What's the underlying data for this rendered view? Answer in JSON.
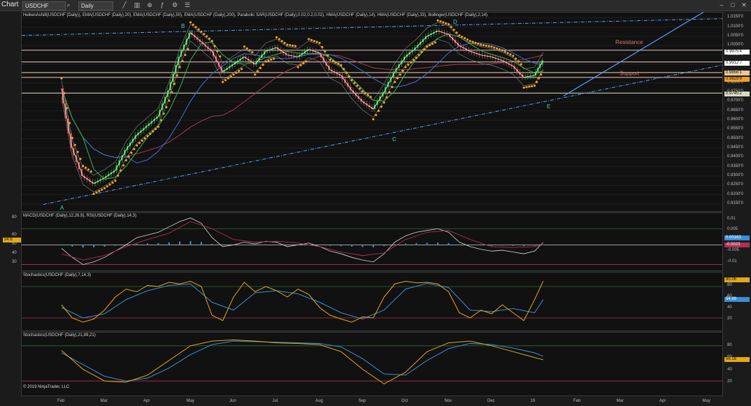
{
  "toolbar": {
    "title": "Chart",
    "instrument": "USDCHF",
    "interval": "Daily"
  },
  "panels": {
    "price_title": "HeikenAshi8(USDCHF (Daily)), EMA(USDCHF (Daily),20), EMA(USDCHF (Daily),50), EMA(USDCHF (Daily),200), Parabolic SAR(USDCHF (Daily),0.02,0.2,0.02), HMA(USDCHF (Daily),14), HMA(USDCHF (Daily),33), Bollinger(USDCHF (Daily),2,14)",
    "macd_title": "MACD(USDCHF (Daily),12,26,9), RSI(USDCHF (Daily),14,3)",
    "stoch1_title": "Stochastics(USDCHF (Daily),7,14,3)",
    "stoch2_title": "Stochastics(USDCHF (Daily),21,89,21)",
    "copyright": "© 2019 NinjaTrader, LLC"
  },
  "price_labels": {
    "resistance": "Resistance",
    "support": "Support",
    "A": "A",
    "B": "B",
    "C": "C",
    "D": "D",
    "E": "E"
  },
  "price_ticks": [
    "1.0150'0",
    "1.0100'0",
    "1.0050'0",
    "1.0000'0",
    "0.9950'0",
    "0.9900'0",
    "0.9850'0",
    "0.9800'0",
    "0.9750'0",
    "0.9700'0",
    "0.9650'0",
    "0.9600'0",
    "0.9550'0",
    "0.9500'0",
    "0.9450'0",
    "0.9400'0",
    "0.9350'0",
    "0.9300'0",
    "0.9250'0",
    "0.9200'0",
    "0.9150'0"
  ],
  "price_tags": [
    "0.9975'4",
    "0.9912'7",
    "0.9856'1",
    "0.9829'9",
    "0.9745'2"
  ],
  "macd_ticks_left": [
    "80",
    "60",
    "50",
    "40",
    "30"
  ],
  "macd_ticks_right": [
    "0.01",
    "0.005",
    "-0.005",
    "-0.01"
  ],
  "macd_tags": {
    "rsi_left": "54.6",
    "macd": "0.00163",
    "signal": "-0.0023"
  },
  "stoch_ticks": [
    "80",
    "60",
    "40",
    "20"
  ],
  "stoch1_tags": [
    "90.06",
    "54.89"
  ],
  "stoch2_tags": [
    "56.16"
  ],
  "x_labels": [
    "Feb",
    "Mar",
    "Apr",
    "May",
    "Jun",
    "Jul",
    "Aug",
    "Sep",
    "Oct",
    "Nov",
    "Dec",
    "19",
    "Feb",
    "Mar",
    "Apr",
    "May"
  ],
  "colors": {
    "background": "#111111",
    "bull_candle": "#2ecc40",
    "bear_candle": "#e05a5a",
    "sar_dots": "#f0a020",
    "ema20": "#3cb44b",
    "ema50": "#4070d0",
    "ema200": "#a04050",
    "hma14": "#e6e6e6",
    "trendline": "#5aa0ff",
    "resistance": "#f3c6c6",
    "stoch_k": "#e6a817",
    "stoch_d": "#3a8fd8",
    "macd_hist": "#3a8fd8",
    "level_line": "#b03050"
  },
  "chart_data": [
    {
      "type": "candlestick",
      "title": "HeikenAshi8(USDCHF (Daily)), EMA(USDCHF (Daily),20), EMA(USDCHF (Daily),50), EMA(USDCHF (Daily),200), Parabolic SAR(USDCHF (Daily),0.02,0.2,0.02), HMA(USDCHF (Daily),14), HMA(USDCHF (Daily),33), Bollinger(USDCHF (Daily),2,14)",
      "ylim": [
        0.912,
        1.017
      ],
      "x": [
        "Feb",
        "Mar",
        "Apr",
        "May",
        "Jun",
        "Jul",
        "Aug",
        "Sep",
        "Oct",
        "Nov",
        "Dec",
        "19",
        "Feb",
        "Mar",
        "Apr",
        "May"
      ],
      "series": [
        {
          "name": "USDCHF",
          "points": [
            [
              0.0,
              0.977
            ],
            [
              0.25,
              0.945
            ],
            [
              0.5,
              0.93
            ],
            [
              0.75,
              0.926
            ],
            [
              1.0,
              0.929
            ],
            [
              1.25,
              0.933
            ],
            [
              1.5,
              0.944
            ],
            [
              1.75,
              0.952
            ],
            [
              2.0,
              0.957
            ],
            [
              2.25,
              0.962
            ],
            [
              2.5,
              0.976
            ],
            [
              2.75,
              0.994
            ],
            [
              3.0,
              1.007
            ],
            [
              3.25,
              1.002
            ],
            [
              3.5,
              0.997
            ],
            [
              3.75,
              0.986
            ],
            [
              4.0,
              0.99
            ],
            [
              4.25,
              0.994
            ],
            [
              4.5,
              0.99
            ],
            [
              4.75,
              0.997
            ],
            [
              5.0,
              0.999
            ],
            [
              5.25,
              0.995
            ],
            [
              5.5,
              0.994
            ],
            [
              5.75,
              0.998
            ],
            [
              6.0,
              0.996
            ],
            [
              6.25,
              0.987
            ],
            [
              6.5,
              0.984
            ],
            [
              6.75,
              0.976
            ],
            [
              7.0,
              0.97
            ],
            [
              7.25,
              0.966
            ],
            [
              7.5,
              0.975
            ],
            [
              7.75,
              0.986
            ],
            [
              8.0,
              0.994
            ],
            [
              8.25,
              0.999
            ],
            [
              8.5,
              1.005
            ],
            [
              8.75,
              1.008
            ],
            [
              9.0,
              1.006
            ],
            [
              9.25,
              1.0
            ],
            [
              9.5,
              0.997
            ],
            [
              9.75,
              0.995
            ],
            [
              10.0,
              0.994
            ],
            [
              10.25,
              0.992
            ],
            [
              10.5,
              0.989
            ],
            [
              10.75,
              0.983
            ],
            [
              11.0,
              0.984
            ],
            [
              11.2,
              0.992
            ]
          ]
        }
      ],
      "horizontal_levels": [
        0.99754,
        0.99127,
        0.98561,
        0.98299,
        0.97452
      ],
      "annotations": [
        "A",
        "B",
        "C",
        "D",
        "E",
        "Resistance",
        "Support"
      ]
    },
    {
      "type": "line",
      "title": "MACD(USDCHF (Daily),12,26,9), RSI(USDCHF (Daily),14,3)",
      "ylim": [
        25,
        85
      ],
      "series": [
        {
          "name": "RSI",
          "points": [
            [
              0.0,
              48
            ],
            [
              0.25,
              38
            ],
            [
              0.5,
              30
            ],
            [
              0.75,
              33
            ],
            [
              1.0,
              38
            ],
            [
              1.25,
              45
            ],
            [
              1.5,
              52
            ],
            [
              1.75,
              60
            ],
            [
              2.0,
              63
            ],
            [
              2.25,
              66
            ],
            [
              2.5,
              72
            ],
            [
              2.75,
              78
            ],
            [
              3.0,
              82
            ],
            [
              3.25,
              76
            ],
            [
              3.5,
              60
            ],
            [
              3.75,
              50
            ],
            [
              4.0,
              52
            ],
            [
              4.25,
              55
            ],
            [
              4.5,
              53
            ],
            [
              4.75,
              56
            ],
            [
              5.0,
              55
            ],
            [
              5.25,
              50
            ],
            [
              5.5,
              52
            ],
            [
              5.75,
              54
            ],
            [
              6.0,
              50
            ],
            [
              6.25,
              45
            ],
            [
              6.5,
              42
            ],
            [
              6.75,
              38
            ],
            [
              7.0,
              35
            ],
            [
              7.25,
              33
            ],
            [
              7.5,
              42
            ],
            [
              7.75,
              55
            ],
            [
              8.0,
              62
            ],
            [
              8.25,
              66
            ],
            [
              8.5,
              68
            ],
            [
              8.75,
              70
            ],
            [
              9.0,
              66
            ],
            [
              9.25,
              55
            ],
            [
              9.5,
              50
            ],
            [
              9.75,
              47
            ],
            [
              10.0,
              45
            ],
            [
              10.25,
              46
            ],
            [
              10.5,
              44
            ],
            [
              10.75,
              42
            ],
            [
              11.0,
              45
            ],
            [
              11.2,
              54.6
            ]
          ]
        },
        {
          "name": "MACD",
          "points": [
            [
              0.0,
              42
            ],
            [
              0.5,
              35
            ],
            [
              1.0,
              40
            ],
            [
              1.5,
              50
            ],
            [
              2.0,
              58
            ],
            [
              2.5,
              65
            ],
            [
              3.0,
              78
            ],
            [
              3.5,
              70
            ],
            [
              4.0,
              58
            ],
            [
              4.5,
              55
            ],
            [
              5.0,
              56
            ],
            [
              5.5,
              54
            ],
            [
              6.0,
              50
            ],
            [
              6.5,
              44
            ],
            [
              7.0,
              40
            ],
            [
              7.5,
              43
            ],
            [
              8.0,
              58
            ],
            [
              8.5,
              66
            ],
            [
              9.0,
              68
            ],
            [
              9.5,
              58
            ],
            [
              10.0,
              50
            ],
            [
              10.5,
              49
            ],
            [
              11.0,
              50
            ],
            [
              11.2,
              52
            ]
          ]
        }
      ]
    },
    {
      "type": "line",
      "title": "Stochastics(USDCHF (Daily),7,14,3)",
      "ylim": [
        0,
        100
      ],
      "series": [
        {
          "name": "K",
          "points": [
            [
              0.0,
              45
            ],
            [
              0.25,
              20
            ],
            [
              0.5,
              12
            ],
            [
              0.75,
              18
            ],
            [
              1.0,
              35
            ],
            [
              1.25,
              60
            ],
            [
              1.5,
              75
            ],
            [
              1.75,
              70
            ],
            [
              2.0,
              82
            ],
            [
              2.25,
              80
            ],
            [
              2.5,
              88
            ],
            [
              2.75,
              85
            ],
            [
              3.0,
              90
            ],
            [
              3.25,
              80
            ],
            [
              3.5,
              25
            ],
            [
              3.75,
              15
            ],
            [
              4.0,
              60
            ],
            [
              4.25,
              88
            ],
            [
              4.5,
              70
            ],
            [
              4.75,
              80
            ],
            [
              5.0,
              72
            ],
            [
              5.25,
              60
            ],
            [
              5.5,
              75
            ],
            [
              5.75,
              65
            ],
            [
              6.0,
              40
            ],
            [
              6.25,
              25
            ],
            [
              6.5,
              18
            ],
            [
              6.75,
              12
            ],
            [
              7.0,
              22
            ],
            [
              7.25,
              20
            ],
            [
              7.5,
              60
            ],
            [
              7.75,
              85
            ],
            [
              8.0,
              90
            ],
            [
              8.25,
              87
            ],
            [
              8.5,
              88
            ],
            [
              8.75,
              85
            ],
            [
              9.0,
              70
            ],
            [
              9.25,
              30
            ],
            [
              9.5,
              20
            ],
            [
              9.75,
              35
            ],
            [
              10.0,
              28
            ],
            [
              10.25,
              45
            ],
            [
              10.5,
              30
            ],
            [
              10.75,
              15
            ],
            [
              11.0,
              55
            ],
            [
              11.2,
              90.06
            ]
          ]
        },
        {
          "name": "D",
          "points": [
            [
              0.0,
              40
            ],
            [
              0.5,
              20
            ],
            [
              1.0,
              28
            ],
            [
              1.5,
              55
            ],
            [
              2.0,
              72
            ],
            [
              2.5,
              82
            ],
            [
              3.0,
              85
            ],
            [
              3.5,
              50
            ],
            [
              4.0,
              35
            ],
            [
              4.5,
              68
            ],
            [
              5.0,
              72
            ],
            [
              5.5,
              66
            ],
            [
              6.0,
              50
            ],
            [
              6.5,
              30
            ],
            [
              7.0,
              18
            ],
            [
              7.5,
              35
            ],
            [
              8.0,
              75
            ],
            [
              8.5,
              86
            ],
            [
              9.0,
              78
            ],
            [
              9.5,
              35
            ],
            [
              10.0,
              32
            ],
            [
              10.5,
              38
            ],
            [
              11.0,
              30
            ],
            [
              11.2,
              54.89
            ]
          ]
        }
      ]
    },
    {
      "type": "line",
      "title": "Stochastics(USDCHF (Daily),21,89,21)",
      "ylim": [
        0,
        100
      ],
      "series": [
        {
          "name": "K",
          "points": [
            [
              0.0,
              72
            ],
            [
              0.5,
              40
            ],
            [
              1.0,
              20
            ],
            [
              1.5,
              18
            ],
            [
              2.0,
              30
            ],
            [
              2.5,
              55
            ],
            [
              3.0,
              80
            ],
            [
              3.5,
              88
            ],
            [
              4.0,
              90
            ],
            [
              4.5,
              88
            ],
            [
              5.0,
              85
            ],
            [
              5.5,
              84
            ],
            [
              6.0,
              82
            ],
            [
              6.5,
              70
            ],
            [
              7.0,
              40
            ],
            [
              7.5,
              15
            ],
            [
              8.0,
              35
            ],
            [
              8.5,
              70
            ],
            [
              9.0,
              85
            ],
            [
              9.5,
              88
            ],
            [
              10.0,
              80
            ],
            [
              10.5,
              70
            ],
            [
              11.0,
              60
            ],
            [
              11.2,
              56.16
            ]
          ]
        },
        {
          "name": "D",
          "points": [
            [
              0.0,
              68
            ],
            [
              0.5,
              48
            ],
            [
              1.0,
              28
            ],
            [
              1.5,
              20
            ],
            [
              2.0,
              25
            ],
            [
              2.5,
              42
            ],
            [
              3.0,
              65
            ],
            [
              3.5,
              82
            ],
            [
              4.0,
              88
            ],
            [
              4.5,
              87
            ],
            [
              5.0,
              86
            ],
            [
              5.5,
              85
            ],
            [
              6.0,
              84
            ],
            [
              6.5,
              78
            ],
            [
              7.0,
              58
            ],
            [
              7.5,
              32
            ],
            [
              8.0,
              30
            ],
            [
              8.5,
              55
            ],
            [
              9.0,
              75
            ],
            [
              9.5,
              84
            ],
            [
              10.0,
              82
            ],
            [
              10.5,
              76
            ],
            [
              11.0,
              68
            ],
            [
              11.2,
              62
            ]
          ]
        }
      ]
    }
  ]
}
